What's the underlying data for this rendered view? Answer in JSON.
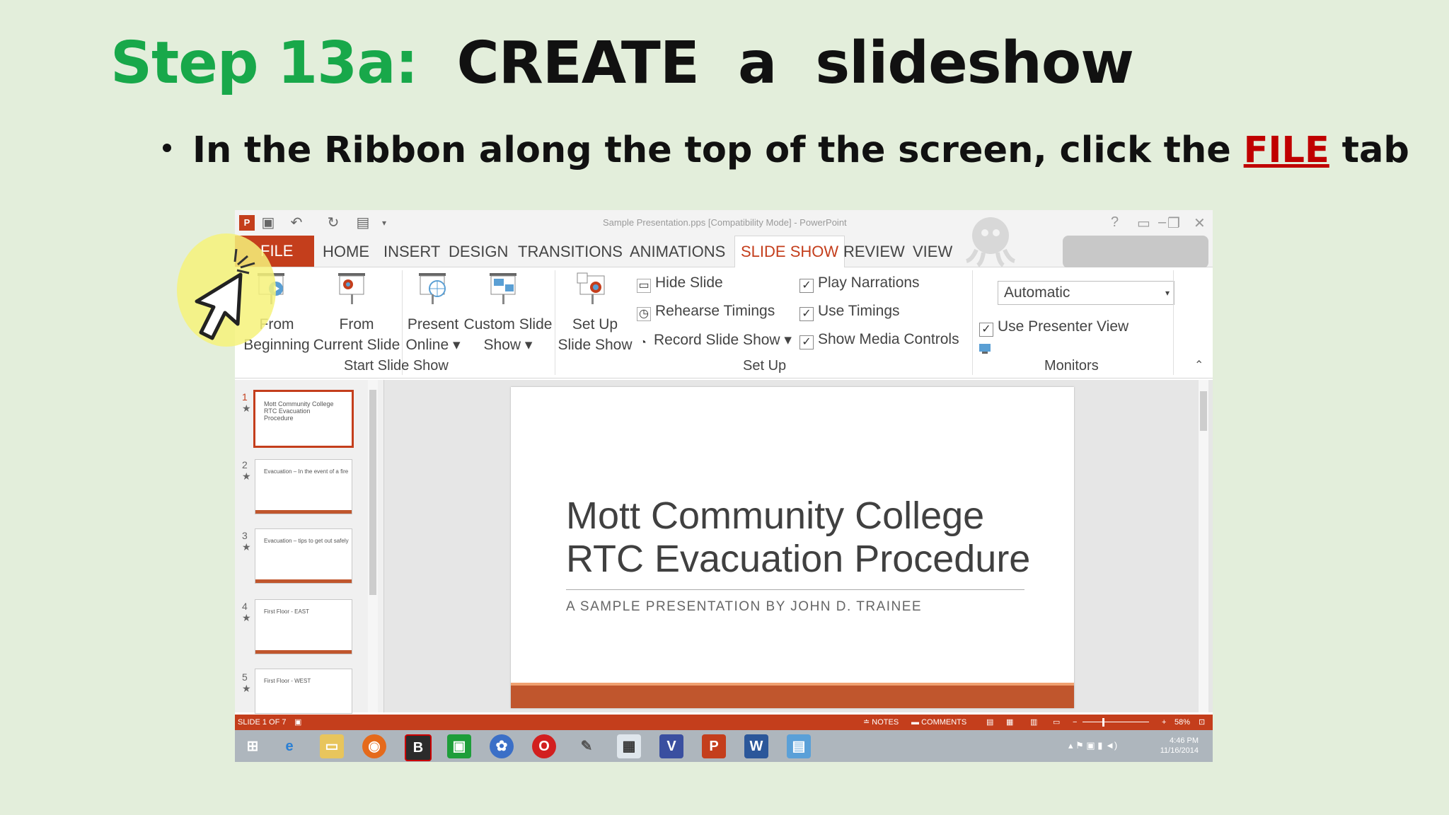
{
  "slide": {
    "title_step": "Step 13a:",
    "title_main": "CREATE  a  slideshow",
    "bullet_before": "In the Ribbon along the top of the screen, click the ",
    "bullet_emph": "FILE",
    "bullet_after": " tab"
  },
  "window": {
    "title": "Sample Presentation.pps [Compatibility Mode] - PowerPoint"
  },
  "tabs": [
    "FILE",
    "HOME",
    "INSERT",
    "DESIGN",
    "TRANSITIONS",
    "ANIMATIONS",
    "SLIDE SHOW",
    "REVIEW",
    "VIEW"
  ],
  "active_tab": "SLIDE SHOW",
  "ribbon": {
    "from_beginning": [
      "From",
      "Beginning"
    ],
    "from_current": [
      "From",
      "Current Slide"
    ],
    "present_online": [
      "Present",
      "Online"
    ],
    "custom_show": [
      "Custom Slide",
      "Show"
    ],
    "start_group": "Start Slide Show",
    "setup_show": [
      "Set Up",
      "Slide Show"
    ],
    "hide_slide": "Hide Slide",
    "rehearse": "Rehearse Timings",
    "record": "Record Slide Show",
    "play_narrations": "Play Narrations",
    "use_timings": "Use Timings",
    "show_media": "Show Media Controls",
    "setup_group": "Set Up",
    "monitor_value": "Automatic",
    "presenter_view": "Use Presenter View",
    "monitors_group": "Monitors"
  },
  "thumbnails": [
    {
      "num": "1",
      "text": "Mott Community College RTC Evacuation Procedure"
    },
    {
      "num": "2",
      "text": "Evacuation – In the event of a fire"
    },
    {
      "num": "3",
      "text": "Evacuation – tips to get out safely"
    },
    {
      "num": "4",
      "text": "First Floor - EAST"
    },
    {
      "num": "5",
      "text": "First Floor - WEST"
    }
  ],
  "main_slide": {
    "line1": "Mott Community College",
    "line2": "RTC Evacuation Procedure",
    "subtitle": "A SAMPLE PRESENTATION BY JOHN D. TRAINEE"
  },
  "status": {
    "slide_info": "SLIDE 1 OF 7",
    "notes": "NOTES",
    "comments": "COMMENTS",
    "zoom": "58%"
  },
  "clock": {
    "time": "4:46 PM",
    "date": "11/16/2014"
  }
}
